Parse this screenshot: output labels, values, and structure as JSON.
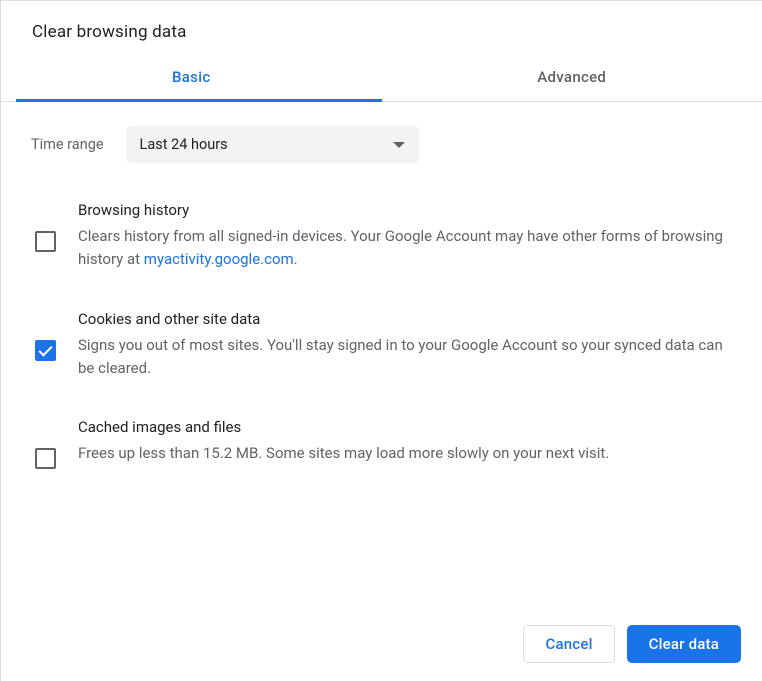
{
  "dialog": {
    "title": "Clear browsing data"
  },
  "tabs": {
    "basic": "Basic",
    "advanced": "Advanced",
    "active": "basic"
  },
  "time_range": {
    "label": "Time range",
    "selected": "Last 24 hours"
  },
  "options": {
    "browsing_history": {
      "title": "Browsing history",
      "desc_before": "Clears history from all signed-in devices. Your Google Account may have other forms of browsing history at ",
      "link_text": "myactivity.google.com",
      "desc_after": ".",
      "checked": false
    },
    "cookies": {
      "title": "Cookies and other site data",
      "desc": "Signs you out of most sites. You'll stay signed in to your Google Account so your synced data can be cleared.",
      "checked": true
    },
    "cache": {
      "title": "Cached images and files",
      "desc": "Frees up less than 15.2 MB. Some sites may load more slowly on your next visit.",
      "checked": false
    }
  },
  "buttons": {
    "cancel": "Cancel",
    "clear": "Clear data"
  }
}
